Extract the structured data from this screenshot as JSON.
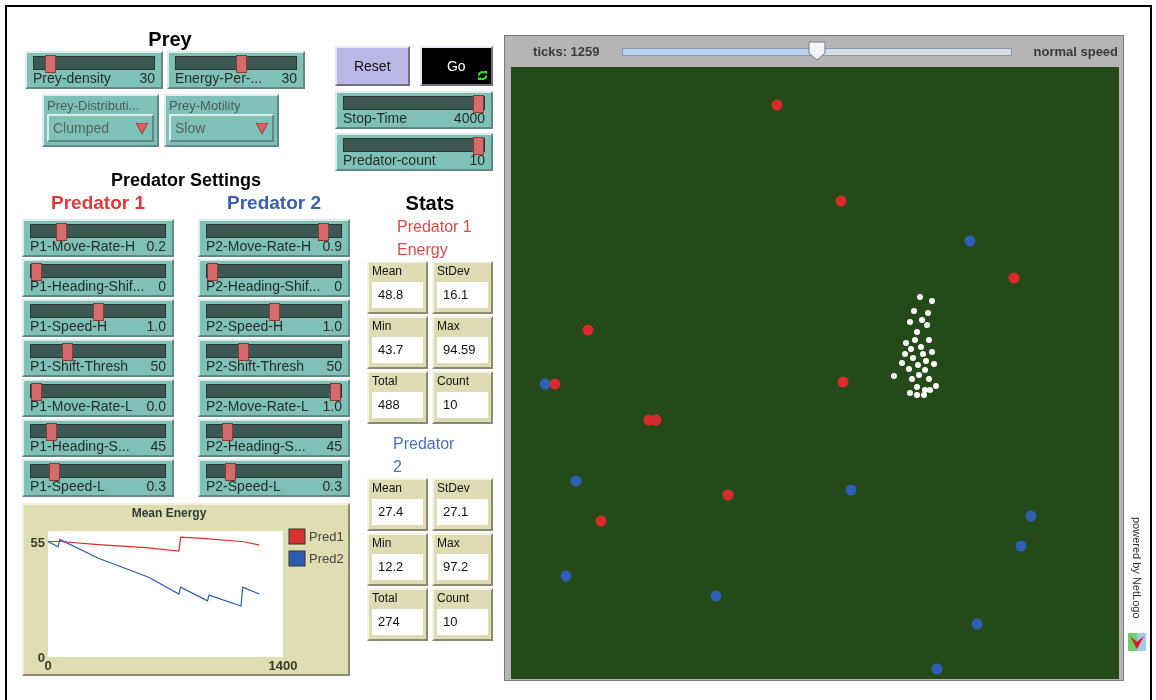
{
  "prey": {
    "title": "Prey",
    "sliders": [
      {
        "label": "Prey-density",
        "value": "30",
        "level": 0.1
      },
      {
        "label": "Energy-Per-...",
        "value": "30",
        "level": 0.55
      }
    ],
    "choosers": [
      {
        "label": "Prey-Distributi...",
        "value": "Clumped"
      },
      {
        "label": "Prey-Motility",
        "value": "Slow"
      }
    ]
  },
  "controls": {
    "buttons": [
      {
        "kind": "once",
        "label": "Reset",
        "running": false
      },
      {
        "kind": "forever",
        "label": "Go",
        "running": true
      }
    ],
    "sliders": [
      {
        "label": "Stop-Time",
        "value": "4000",
        "level": 1.0
      },
      {
        "label": "Predator-count",
        "value": "10",
        "level": 1.0
      }
    ]
  },
  "predator_settings": {
    "title": "Predator Settings",
    "groups": [
      {
        "title": "Predator 1",
        "color": "#e0393b",
        "sliders": [
          {
            "label": "P1-Move-Rate-H",
            "value": "0.2",
            "level": 0.2
          },
          {
            "label": "P1-Heading-Shif...",
            "value": "0",
            "level": 0.0
          },
          {
            "label": "P1-Speed-H",
            "value": "1.0",
            "level": 0.5
          },
          {
            "label": "P1-Shift-Thresh",
            "value": "50",
            "level": 0.25
          },
          {
            "label": "P1-Move-Rate-L",
            "value": "0.0",
            "level": 0.0
          },
          {
            "label": "P1-Heading-S...",
            "value": "45",
            "level": 0.12
          },
          {
            "label": "P1-Speed-L",
            "value": "0.3",
            "level": 0.15
          }
        ]
      },
      {
        "title": "Predator 2",
        "color": "#3a5fb0",
        "sliders": [
          {
            "label": "P2-Move-Rate-H",
            "value": "0.9",
            "level": 0.9
          },
          {
            "label": "P2-Heading-Shif...",
            "value": "0",
            "level": 0.0
          },
          {
            "label": "P2-Speed-H",
            "value": "1.0",
            "level": 0.5
          },
          {
            "label": "P2-Shift-Thresh",
            "value": "50",
            "level": 0.25
          },
          {
            "label": "P2-Move-Rate-L",
            "value": "1.0",
            "level": 1.0
          },
          {
            "label": "P2-Heading-S...",
            "value": "45",
            "level": 0.12
          },
          {
            "label": "P2-Speed-L",
            "value": "0.3",
            "level": 0.15
          }
        ]
      }
    ]
  },
  "stats": {
    "title": "Stats",
    "groups": [
      {
        "title": "Predator 1 Energy",
        "color": "#e04848",
        "monitors": [
          {
            "label": "Mean",
            "value": "48.8"
          },
          {
            "label": "StDev",
            "value": "16.1"
          },
          {
            "label": "Min",
            "value": "43.7"
          },
          {
            "label": "Max",
            "value": "94.59"
          },
          {
            "label": "Total",
            "value": "488"
          },
          {
            "label": "Count",
            "value": "10"
          }
        ]
      },
      {
        "title": "Predator 2",
        "color": "#4a6fc0",
        "monitors": [
          {
            "label": "Mean",
            "value": "27.4"
          },
          {
            "label": "StDev",
            "value": "27.1"
          },
          {
            "label": "Min",
            "value": "12.2"
          },
          {
            "label": "Max",
            "value": "97.2"
          },
          {
            "label": "Total",
            "value": "274"
          },
          {
            "label": "Count",
            "value": "10"
          }
        ]
      }
    ]
  },
  "plot": {
    "chart_data": {
      "type": "line",
      "title": "Mean Energy",
      "x": [
        0,
        60,
        70,
        300,
        600,
        780,
        790,
        950,
        960,
        1150,
        1160,
        1259
      ],
      "series": [
        {
          "name": "Pred1",
          "color": "#d93030",
          "values": [
            55,
            55,
            55,
            53.5,
            52,
            50.5,
            57.1,
            56.4,
            56.3,
            55,
            55,
            53.3
          ]
        },
        {
          "name": "Pred2",
          "color": "#2c5cb0",
          "values": [
            55,
            52.5,
            56,
            47,
            38,
            30,
            33.3,
            26.7,
            29.5,
            24.3,
            33.3,
            30
          ]
        }
      ],
      "xlim": [
        0,
        1400
      ],
      "ylim": [
        0,
        60
      ],
      "xticks": [
        0,
        1400
      ],
      "yticks": [
        0,
        55
      ],
      "legend": "right"
    }
  },
  "view": {
    "ticks_label": "ticks: 1259",
    "speed": {
      "level": 0.5,
      "label": "normal speed"
    }
  },
  "footer": "powered by NetLogo"
}
